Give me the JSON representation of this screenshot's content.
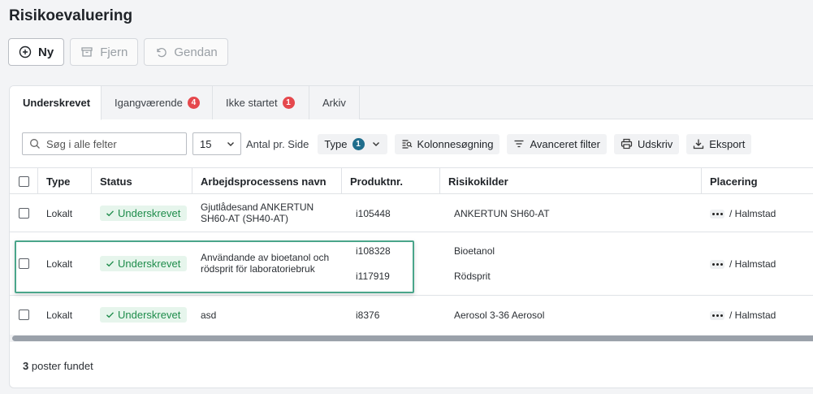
{
  "page": {
    "title": "Risikoevaluering"
  },
  "toolbar": {
    "new_label": "Ny",
    "remove_label": "Fjern",
    "restore_label": "Gendan"
  },
  "tabs": [
    {
      "label": "Underskrevet",
      "badge": null
    },
    {
      "label": "Igangværende",
      "badge": "4"
    },
    {
      "label": "Ikke startet",
      "badge": "1"
    },
    {
      "label": "Arkiv",
      "badge": null
    }
  ],
  "filters": {
    "search_placeholder": "Søg i alle felter",
    "page_size": "15",
    "page_size_label": "Antal pr. Side",
    "type_label": "Type",
    "type_count": "1",
    "column_search_label": "Kolonnesøgning",
    "advanced_filter_label": "Avanceret filter",
    "print_label": "Udskriv",
    "export_label": "Eksport"
  },
  "table": {
    "columns": [
      "Type",
      "Status",
      "Arbejdsprocessens navn",
      "Produktnr.",
      "Risikokilder",
      "Placering"
    ],
    "rows": [
      {
        "type": "Lokalt",
        "status": "Underskrevet",
        "name_lines": [
          "Gjutlådesand ANKERTUN",
          "SH60-AT (SH40-AT)"
        ],
        "products": [
          "i105448"
        ],
        "sources": [
          "ANKERTUN SH60-AT"
        ],
        "location": "/ Halmstad"
      },
      {
        "type": "Lokalt",
        "status": "Underskrevet",
        "name_lines": [
          "Användande av bioetanol och",
          "rödsprit för laboratoriebruk"
        ],
        "products": [
          "i108328",
          "i117919"
        ],
        "sources": [
          "Bioetanol",
          "Rödsprit"
        ],
        "location": "/ Halmstad"
      },
      {
        "type": "Lokalt",
        "status": "Underskrevet",
        "name_lines": [
          "asd"
        ],
        "products": [
          "i8376"
        ],
        "sources": [
          "Aerosol 3-36 Aerosol"
        ],
        "location": "/ Halmstad"
      }
    ]
  },
  "footer": {
    "count": "3",
    "text": "poster fundet"
  },
  "colors": {
    "status_green": "#1e8c4b",
    "badge_red": "#e5484d",
    "highlight": "#4aa58a"
  }
}
